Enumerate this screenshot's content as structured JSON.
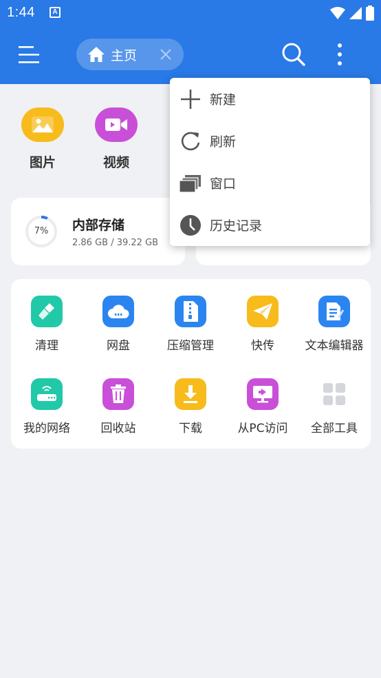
{
  "status_bar": {
    "time": "1:44",
    "notification_letter": "A"
  },
  "toolbar": {
    "tab_label": "主页"
  },
  "quick_access": [
    {
      "label": "图片",
      "icon": "image-icon",
      "color": "#f8bb1c"
    },
    {
      "label": "视频",
      "icon": "video-icon",
      "color": "#c94fd8"
    }
  ],
  "storage": {
    "percent_label": "7%",
    "percent": 7,
    "title": "内部存储",
    "usage": "2.86 GB / 39.22 GB"
  },
  "tools": [
    {
      "label": "清理",
      "icon": "broom-icon",
      "color": "#21c9a8"
    },
    {
      "label": "网盘",
      "icon": "cloud-icon",
      "color": "#2b85f0"
    },
    {
      "label": "压缩管理",
      "icon": "zip-icon",
      "color": "#2b85f0"
    },
    {
      "label": "快传",
      "icon": "paper-plane-icon",
      "color": "#f8bb1c"
    },
    {
      "label": "文本编辑器",
      "icon": "document-icon",
      "color": "#2b85f0"
    },
    {
      "label": "我的网络",
      "icon": "router-icon",
      "color": "#21c9a8"
    },
    {
      "label": "回收站",
      "icon": "trash-icon",
      "color": "#c94fd8"
    },
    {
      "label": "下载",
      "icon": "download-icon",
      "color": "#f8bb1c"
    },
    {
      "label": "从PC访问",
      "icon": "pc-icon",
      "color": "#c94fd8"
    },
    {
      "label": "全部工具",
      "icon": "grid-icon",
      "color": "#d4d6db"
    }
  ],
  "popup_menu": [
    {
      "label": "新建",
      "icon": "plus-icon"
    },
    {
      "label": "刷新",
      "icon": "refresh-icon"
    },
    {
      "label": "窗口",
      "icon": "windows-icon"
    },
    {
      "label": "历史记录",
      "icon": "clock-icon"
    }
  ],
  "colors": {
    "primary": "#2979e6",
    "background": "#f0f1f4"
  }
}
